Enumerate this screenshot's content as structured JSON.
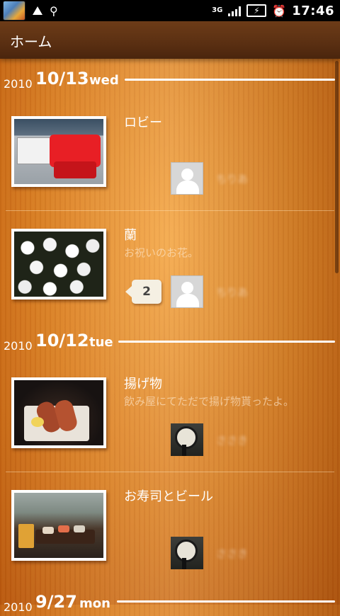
{
  "status_bar": {
    "time": "17:46",
    "network": "3G",
    "icons": [
      "app-icon",
      "warning-icon",
      "usb-icon",
      "signal-icon",
      "battery-charging-icon",
      "alarm-icon"
    ]
  },
  "header": {
    "title": "ホーム"
  },
  "timeline": [
    {
      "year": "2010",
      "day": "10/13",
      "weekday": "wed",
      "items": [
        {
          "title": "ロビー",
          "description": "",
          "count": "",
          "author": "ちりあ",
          "avatar": "default-avatar"
        },
        {
          "title": "蘭",
          "description": "お祝いのお花。",
          "count": "2",
          "author": "ちりあ",
          "avatar": "default-avatar"
        }
      ]
    },
    {
      "year": "2010",
      "day": "10/12",
      "weekday": "tue",
      "items": [
        {
          "title": "揚げ物",
          "description": "飲み屋にてただで揚げ物貰ったよ。",
          "count": "",
          "author": "ささき",
          "avatar": "clock-photo"
        },
        {
          "title": "お寿司とビール",
          "description": "",
          "count": "",
          "author": "ささき",
          "avatar": "clock-photo"
        }
      ]
    },
    {
      "year": "2010",
      "day": "9/27",
      "weekday": "mon",
      "items": []
    }
  ],
  "colors": {
    "wood": "#d77a1d",
    "title_bar": "#5a2f12",
    "text": "#ffffff"
  }
}
